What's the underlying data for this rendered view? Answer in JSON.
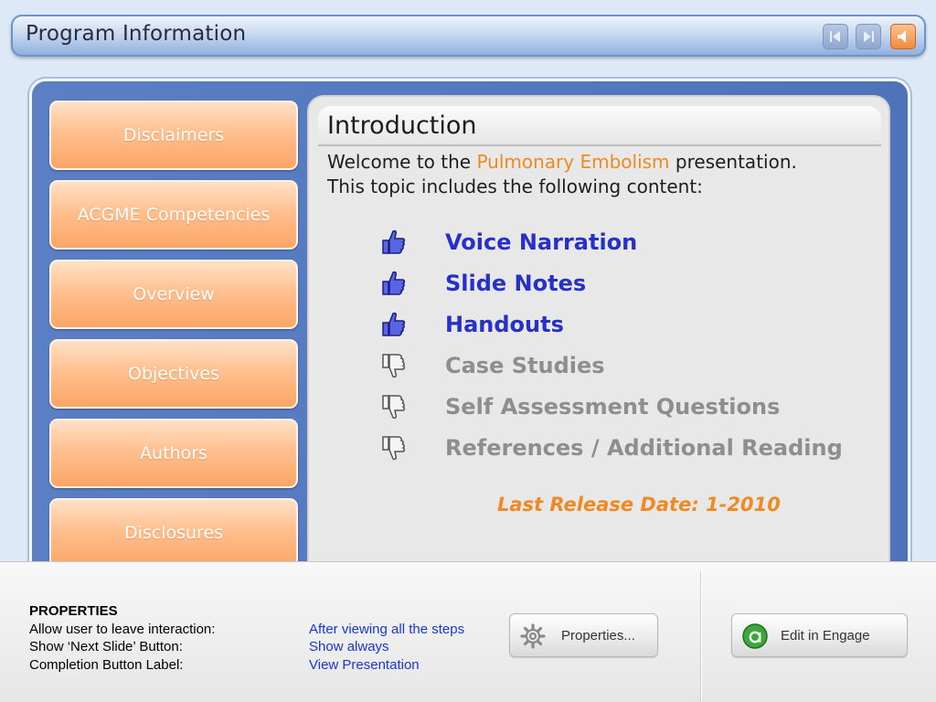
{
  "window": {
    "title": "Program Information",
    "nav": {
      "prev_icon": "prev-arrow-icon",
      "next_icon": "next-arrow-icon",
      "sound_icon": "speaker-icon"
    }
  },
  "sidebar": {
    "items": [
      {
        "label": "Disclaimers"
      },
      {
        "label": "ACGME Competencies"
      },
      {
        "label": "Overview"
      },
      {
        "label": "Objectives"
      },
      {
        "label": "Authors"
      },
      {
        "label": "Disclosures"
      }
    ]
  },
  "content": {
    "heading": "Introduction",
    "welcome_prefix": "Welcome to the",
    "topic": "Pulmonary Embolism",
    "welcome_suffix": "presentation.",
    "welcome_line2": "This topic includes the following content:",
    "items": [
      {
        "label": "Voice Narration",
        "status": "included",
        "icon": "thumbs-up-icon"
      },
      {
        "label": "Slide Notes",
        "status": "included",
        "icon": "thumbs-up-icon"
      },
      {
        "label": "Handouts",
        "status": "included",
        "icon": "thumbs-up-icon"
      },
      {
        "label": "Case Studies",
        "status": "not-included",
        "icon": "thumbs-down-icon"
      },
      {
        "label": "Self Assessment Questions",
        "status": "not-included",
        "icon": "thumbs-down-icon"
      },
      {
        "label": "References / Additional Reading",
        "status": "not-included",
        "icon": "thumbs-down-icon"
      }
    ],
    "release": "Last Release Date: 1-2010"
  },
  "properties": {
    "header": "PROPERTIES",
    "rows": [
      {
        "label": "Allow user to leave interaction:",
        "value": "After viewing all the steps"
      },
      {
        "label": "Show ‘Next Slide’ Button:",
        "value": "Show always"
      },
      {
        "label": "Completion Button Label:",
        "value": "View Presentation"
      }
    ],
    "properties_button": "Properties...",
    "engage_button": "Edit in Engage"
  },
  "colors": {
    "accent_orange": "#ee8a1e",
    "included_blue": "#2730c8",
    "excluded_gray": "#8e8e8e",
    "link_blue": "#1836d6",
    "frame_blue": "#5b7fc4"
  }
}
